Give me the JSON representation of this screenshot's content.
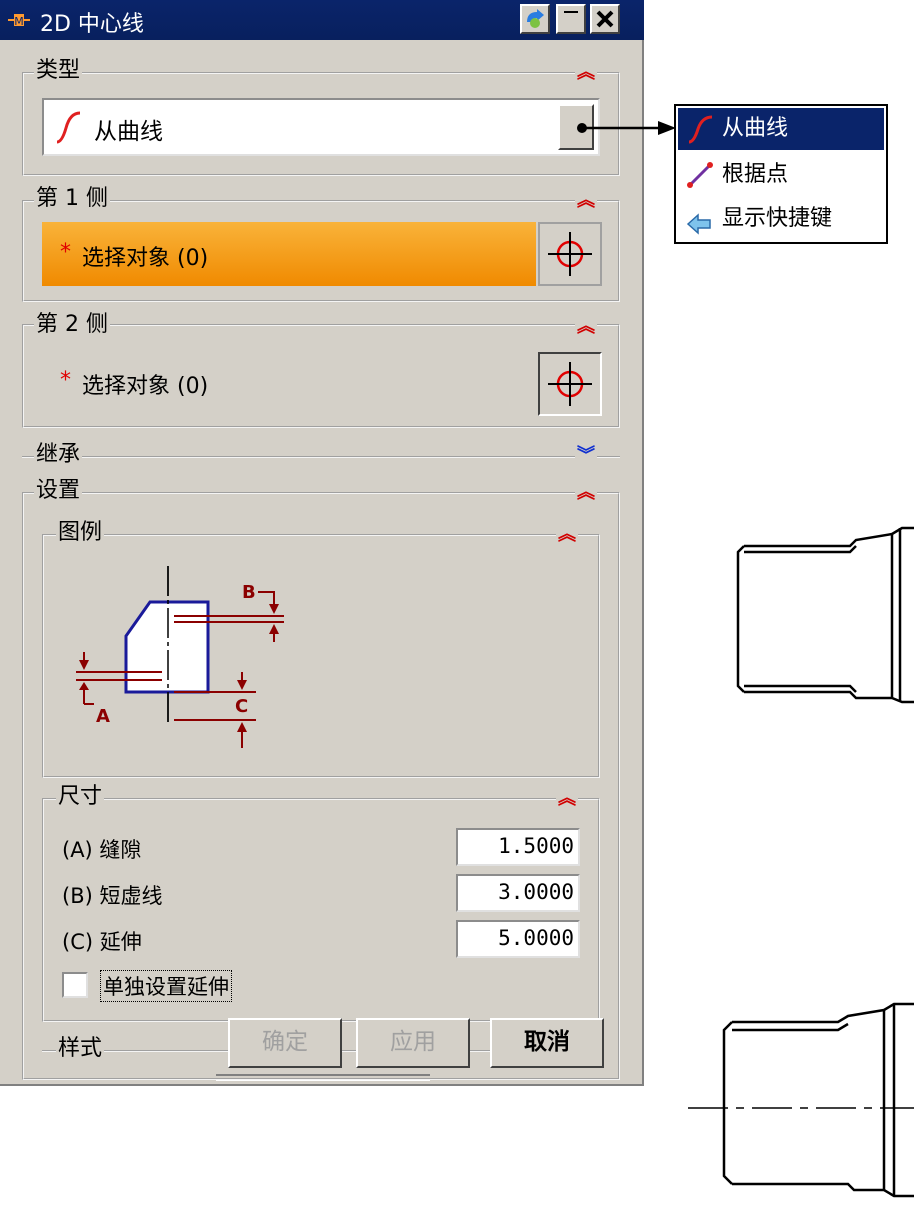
{
  "window": {
    "title": "2D 中心线"
  },
  "type_group": {
    "title": "类型",
    "selected": "从曲线"
  },
  "side1": {
    "title": "第 1 侧",
    "select_label": "选择对象 (0)"
  },
  "side2": {
    "title": "第 2 侧",
    "select_label": "选择对象 (0)"
  },
  "inherit": {
    "title": "继承"
  },
  "settings": {
    "title": "设置",
    "legend_title": "图例",
    "legend_labels": {
      "a": "A",
      "b": "B",
      "c": "C"
    },
    "dimensions": {
      "title": "尺寸",
      "rows": [
        {
          "label": "(A) 缝隙",
          "value": "1.5000"
        },
        {
          "label": "(B) 短虚线",
          "value": "3.0000"
        },
        {
          "label": "(C) 延伸",
          "value": "5.0000"
        }
      ],
      "checkbox_label": "单独设置延伸",
      "checkbox_checked": false
    },
    "style_title": "样式"
  },
  "buttons": {
    "ok": "确定",
    "apply": "应用",
    "cancel": "取消"
  },
  "dropdown": {
    "items": [
      {
        "label": "从曲线",
        "icon": "curve-icon",
        "selected": true
      },
      {
        "label": "根据点",
        "icon": "line-points-icon",
        "selected": false
      },
      {
        "label": "显示快捷键",
        "icon": "arrow-left-icon",
        "selected": false
      }
    ]
  },
  "colors": {
    "title_bar": "#0a246a",
    "selection_highlight": "#f7a21a",
    "collapse_up": "#d10000",
    "collapse_down": "#1030d0",
    "legend": "#8b0000"
  }
}
